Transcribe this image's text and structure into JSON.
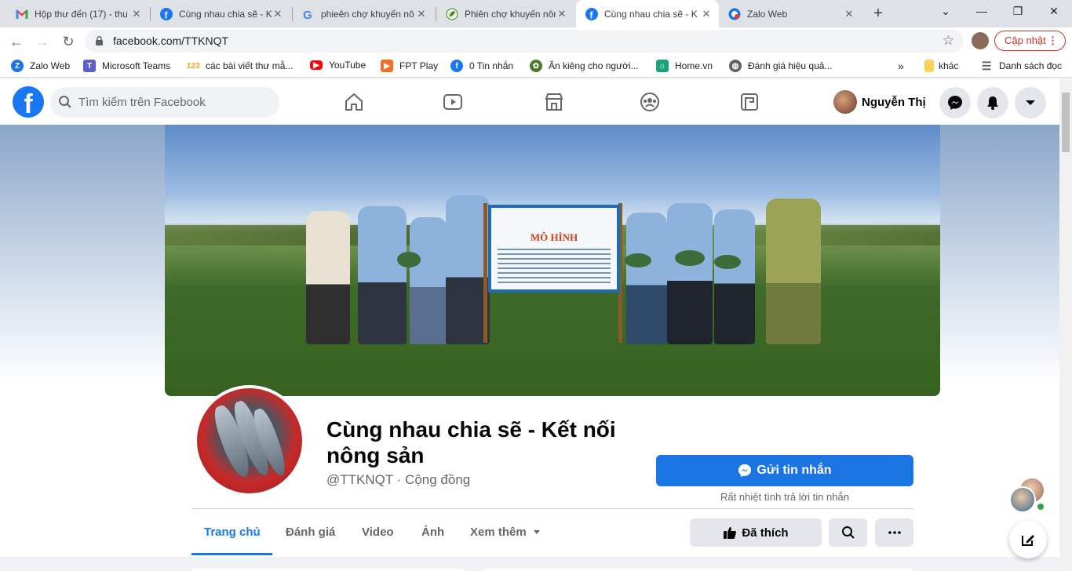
{
  "browser": {
    "tabs": [
      {
        "title": "Hộp thư đến (17) - thu",
        "icon": "gmail-icon"
      },
      {
        "title": "Cùng nhau chia sẽ - K",
        "icon": "facebook-icon"
      },
      {
        "title": "phieên chợ khuyến nô",
        "icon": "google-icon"
      },
      {
        "title": "Phiên chợ khuyến nôn",
        "icon": "leaf-icon"
      },
      {
        "title": "Cùng nhau chia sẽ - K",
        "icon": "facebook-icon"
      },
      {
        "title": "Zalo Web",
        "icon": "zalo-icon"
      }
    ],
    "active_tab_index": 4,
    "url": "facebook.com/TTKNQT",
    "update_label": "Cập nhật",
    "bookmarks": [
      {
        "label": "Zalo Web",
        "icon": "zalo-icon",
        "color": "#1a73e8"
      },
      {
        "label": "Microsoft Teams",
        "icon": "teams-icon",
        "color": "#5b5fc7"
      },
      {
        "label": "các bài viết thư mẫ...",
        "icon": "123-icon",
        "color": "#f6a623"
      },
      {
        "label": "YouTube",
        "icon": "youtube-icon",
        "color": "#ff0000"
      },
      {
        "label": "FPT Play",
        "icon": "fptplay-icon",
        "color": "#f36f21"
      },
      {
        "label": "0 Tin nhắn",
        "icon": "facebook-icon",
        "color": "#1877f2"
      },
      {
        "label": "Ăn kiêng cho người...",
        "icon": "leaf-icon",
        "color": "#4a7a2a"
      },
      {
        "label": "Home.vn",
        "icon": "home-icon",
        "color": "#1aa37a"
      },
      {
        "label": "Đánh giá hiệu quả...",
        "icon": "globe-icon",
        "color": "#5f6368"
      }
    ],
    "bookmarks_more": "»",
    "other_bookmarks": "khác",
    "reading_list": "Danh sách đọc"
  },
  "facebook": {
    "search_placeholder": "Tìm kiếm trên Facebook",
    "user_name": "Nguyễn Thị",
    "brand_color": "#1877f2"
  },
  "page": {
    "name": "Cùng nhau chia sẽ - Kết nối nông sản",
    "handle": "@TTKNQT · Cộng đồng",
    "message_button": "Gửi tin nhắn",
    "message_note": "Rất nhiệt tình trả lời tin nhắn",
    "sign_title": "MÔ HÌNH",
    "tabs": [
      "Trang chủ",
      "Đánh giá",
      "Video",
      "Ảnh",
      "Xem thêm"
    ],
    "liked_label": "Đã thích"
  }
}
